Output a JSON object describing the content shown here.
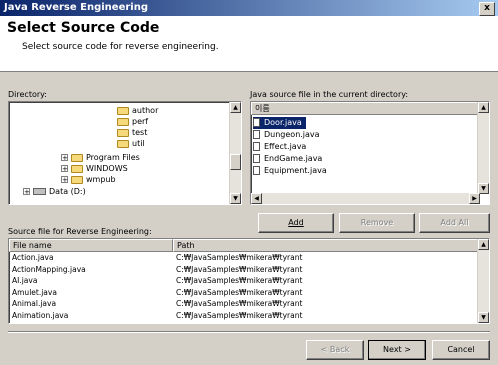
{
  "window": {
    "title": "Java Reverse Engineering",
    "close": "x"
  },
  "header": {
    "title": "Select Source Code",
    "subtitle": "Select source code for reverse engineering."
  },
  "directory": {
    "label": "Directory:",
    "tree": [
      {
        "label": "author",
        "icon": "folder-icon"
      },
      {
        "label": "perf",
        "icon": "folder-icon"
      },
      {
        "label": "test",
        "icon": "folder-icon"
      },
      {
        "label": "util",
        "icon": "folder-icon"
      },
      {
        "label": "Program Files",
        "icon": "folder-icon",
        "expander": "+"
      },
      {
        "label": "WINDOWS",
        "icon": "folder-icon",
        "expander": "+"
      },
      {
        "label": "wmpub",
        "icon": "folder-icon",
        "expander": "+"
      },
      {
        "label": "Data (D:)",
        "icon": "drive-icon",
        "expander": "+"
      }
    ]
  },
  "java_files": {
    "label": "Java source file in the current directory:",
    "column_header": "이름",
    "items": [
      {
        "label": "Door.java",
        "selected": true
      },
      {
        "label": "Dungeon.java",
        "selected": false
      },
      {
        "label": "Effect.java",
        "selected": false
      },
      {
        "label": "EndGame.java",
        "selected": false
      },
      {
        "label": "Equipment.java",
        "selected": false
      }
    ]
  },
  "buttons": {
    "add": "Add",
    "remove": "Remove",
    "add_all": "Add All",
    "back": "< Back",
    "next": "Next >",
    "cancel": "Cancel"
  },
  "source_table": {
    "label": "Source file for Reverse Engineering:",
    "columns": [
      "File name",
      "Path"
    ],
    "rows": [
      {
        "file": "Action.java",
        "path": "C:₩JavaSamples₩mikera₩tyrant"
      },
      {
        "file": "ActionMapping.java",
        "path": "C:₩JavaSamples₩mikera₩tyrant"
      },
      {
        "file": "AI.java",
        "path": "C:₩JavaSamples₩mikera₩tyrant"
      },
      {
        "file": "Amulet.java",
        "path": "C:₩JavaSamples₩mikera₩tyrant"
      },
      {
        "file": "Animal.java",
        "path": "C:₩JavaSamples₩mikera₩tyrant"
      },
      {
        "file": "Animation.java",
        "path": "C:₩JavaSamples₩mikera₩tyrant"
      }
    ]
  }
}
